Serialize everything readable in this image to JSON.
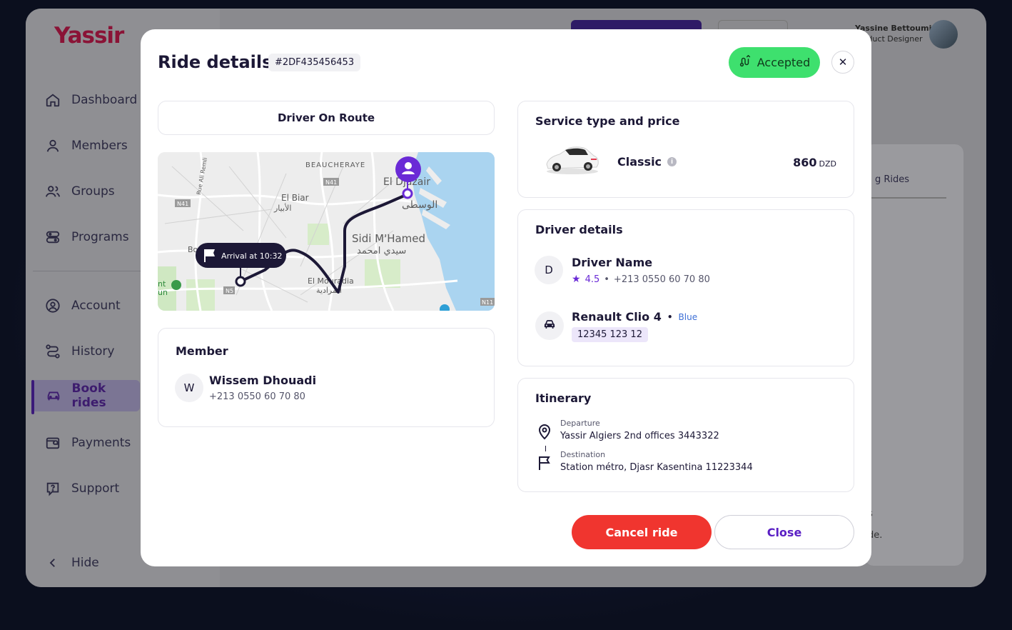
{
  "app": {
    "brand": "Yassir",
    "user_name": "Yassine Bettoumi",
    "user_role": "Product Designer"
  },
  "sidebar": {
    "items": [
      {
        "label": "Dashboard",
        "icon": "home-icon"
      },
      {
        "label": "Members",
        "icon": "user-icon"
      },
      {
        "label": "Groups",
        "icon": "users-icon"
      },
      {
        "label": "Programs",
        "icon": "programs-icon"
      },
      {
        "label": "Account",
        "icon": "account-icon"
      },
      {
        "label": "History",
        "icon": "history-icon"
      },
      {
        "label": "Book rides",
        "icon": "car-icon",
        "active": true
      },
      {
        "label": "Payments",
        "icon": "wallet-icon"
      },
      {
        "label": "Support",
        "icon": "support-icon"
      }
    ],
    "hide_label": "Hide"
  },
  "background": {
    "tab_fragment": "g Rides",
    "text_fragment_1": "s",
    "text_fragment_2": "de."
  },
  "modal": {
    "title": "Ride details",
    "ride_id": "#2DF435456453",
    "status": "Accepted",
    "status_color": "#3ee06e",
    "ride_state": "Driver On Route",
    "map": {
      "arrival_label": "Arrival at 10:32",
      "labels": {
        "beaucheraye": "BEAUCHERAYE",
        "el_djazair": "El Djazair",
        "el_biar": "El Biar",
        "el_biar_ar": "الأبيار",
        "sidi_mhamed": "Sidi M'Hamed",
        "sidi_mhamed_ar": "سيدي امحمد",
        "el_mouradia": "El Mouradia",
        "el_mouradia_ar": "المرادية",
        "el_wusta_ar": "الوسطى",
        "n41": "N41",
        "n11": "N11",
        "n5": "N5",
        "rue": "Rue Ali Remli",
        "bo": "Bo",
        "nt": "nt",
        "un": "un"
      }
    },
    "member": {
      "title": "Member",
      "initial": "W",
      "name": "Wissem Dhouadi",
      "phone": "+213 0550 60 70 80"
    },
    "service": {
      "title": "Service type and price",
      "type": "Classic",
      "price": "860",
      "currency": "DZD"
    },
    "driver": {
      "title": "Driver details",
      "initial": "D",
      "name": "Driver Name",
      "rating": "4.5",
      "phone": "+213 0550 60 70 80",
      "car_model": "Renault Clio 4",
      "car_color": "Blue",
      "plate": "12345 123 12"
    },
    "itinerary": {
      "title": "Itinerary",
      "departure_label": "Departure",
      "departure": "Yassir Algiers 2nd offices 3443322",
      "destination_label": "Destination",
      "destination": "Station métro, Djasr Kasentina 11223344"
    },
    "buttons": {
      "cancel": "Cancel ride",
      "close": "Close"
    },
    "accent_color": "#5a1fc4",
    "danger_color": "#f0352f"
  }
}
